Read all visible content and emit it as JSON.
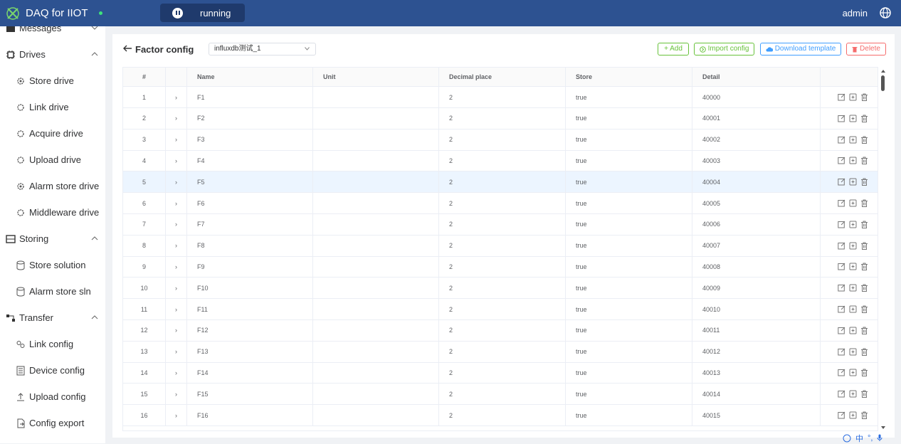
{
  "header": {
    "app_title": "DAQ for IIOT",
    "run_status": "running",
    "user": "admin"
  },
  "sidebar": {
    "items": [
      {
        "label": "Messages",
        "type": "group",
        "icon": "message-icon"
      },
      {
        "label": "Drives",
        "type": "group",
        "icon": "chip-icon"
      },
      {
        "label": "Store drive",
        "type": "sub",
        "icon": "gear-chip-icon"
      },
      {
        "label": "Link drive",
        "type": "sub",
        "icon": "gear-chip-icon"
      },
      {
        "label": "Acquire drive",
        "type": "sub",
        "icon": "gear-chip-icon"
      },
      {
        "label": "Upload drive",
        "type": "sub",
        "icon": "gear-chip-icon"
      },
      {
        "label": "Alarm store drive",
        "type": "sub",
        "icon": "gear-chip-icon"
      },
      {
        "label": "Middleware drive",
        "type": "sub",
        "icon": "gear-chip-icon"
      },
      {
        "label": "Storing",
        "type": "group",
        "icon": "storage-icon"
      },
      {
        "label": "Store solution",
        "type": "sub",
        "icon": "database-icon"
      },
      {
        "label": "Alarm store sln",
        "type": "sub",
        "icon": "database-icon"
      },
      {
        "label": "Transfer",
        "type": "group",
        "icon": "transfer-icon"
      },
      {
        "label": "Link config",
        "type": "sub",
        "icon": "link-icon"
      },
      {
        "label": "Device config",
        "type": "sub",
        "icon": "device-icon"
      },
      {
        "label": "Upload config",
        "type": "sub",
        "icon": "upload-icon"
      },
      {
        "label": "Config export",
        "type": "sub",
        "icon": "export-icon"
      }
    ]
  },
  "toolbar": {
    "title": "Factor config",
    "select_value": "influxdb测试_1",
    "add_label": "+ Add",
    "import_label": "Import config",
    "template_label": "Download template",
    "delete_label": "Delete"
  },
  "table": {
    "columns": [
      "#",
      "",
      "Name",
      "Unit",
      "Decimal place",
      "Store",
      "Detail",
      ""
    ],
    "rows": [
      {
        "idx": "1",
        "name": "F1",
        "unit": "",
        "decimal": "2",
        "store": "true",
        "detail": "40000"
      },
      {
        "idx": "2",
        "name": "F2",
        "unit": "",
        "decimal": "2",
        "store": "true",
        "detail": "40001"
      },
      {
        "idx": "3",
        "name": "F3",
        "unit": "",
        "decimal": "2",
        "store": "true",
        "detail": "40002"
      },
      {
        "idx": "4",
        "name": "F4",
        "unit": "",
        "decimal": "2",
        "store": "true",
        "detail": "40003"
      },
      {
        "idx": "5",
        "name": "F5",
        "unit": "",
        "decimal": "2",
        "store": "true",
        "detail": "40004"
      },
      {
        "idx": "6",
        "name": "F6",
        "unit": "",
        "decimal": "2",
        "store": "true",
        "detail": "40005"
      },
      {
        "idx": "7",
        "name": "F7",
        "unit": "",
        "decimal": "2",
        "store": "true",
        "detail": "40006"
      },
      {
        "idx": "8",
        "name": "F8",
        "unit": "",
        "decimal": "2",
        "store": "true",
        "detail": "40007"
      },
      {
        "idx": "9",
        "name": "F9",
        "unit": "",
        "decimal": "2",
        "store": "true",
        "detail": "40008"
      },
      {
        "idx": "10",
        "name": "F10",
        "unit": "",
        "decimal": "2",
        "store": "true",
        "detail": "40009"
      },
      {
        "idx": "11",
        "name": "F11",
        "unit": "",
        "decimal": "2",
        "store": "true",
        "detail": "40010"
      },
      {
        "idx": "12",
        "name": "F12",
        "unit": "",
        "decimal": "2",
        "store": "true",
        "detail": "40011"
      },
      {
        "idx": "13",
        "name": "F13",
        "unit": "",
        "decimal": "2",
        "store": "true",
        "detail": "40012"
      },
      {
        "idx": "14",
        "name": "F14",
        "unit": "",
        "decimal": "2",
        "store": "true",
        "detail": "40013"
      },
      {
        "idx": "15",
        "name": "F15",
        "unit": "",
        "decimal": "2",
        "store": "true",
        "detail": "40014"
      },
      {
        "idx": "16",
        "name": "F16",
        "unit": "",
        "decimal": "2",
        "store": "true",
        "detail": "40015"
      }
    ],
    "highlighted_row": "5"
  },
  "ime": {
    "lang": "中"
  },
  "colors": {
    "header_bg": "#2d5291",
    "add": "#67c23a",
    "template": "#409eff",
    "delete": "#f56c6c",
    "row_highlight": "#ecf5ff"
  }
}
